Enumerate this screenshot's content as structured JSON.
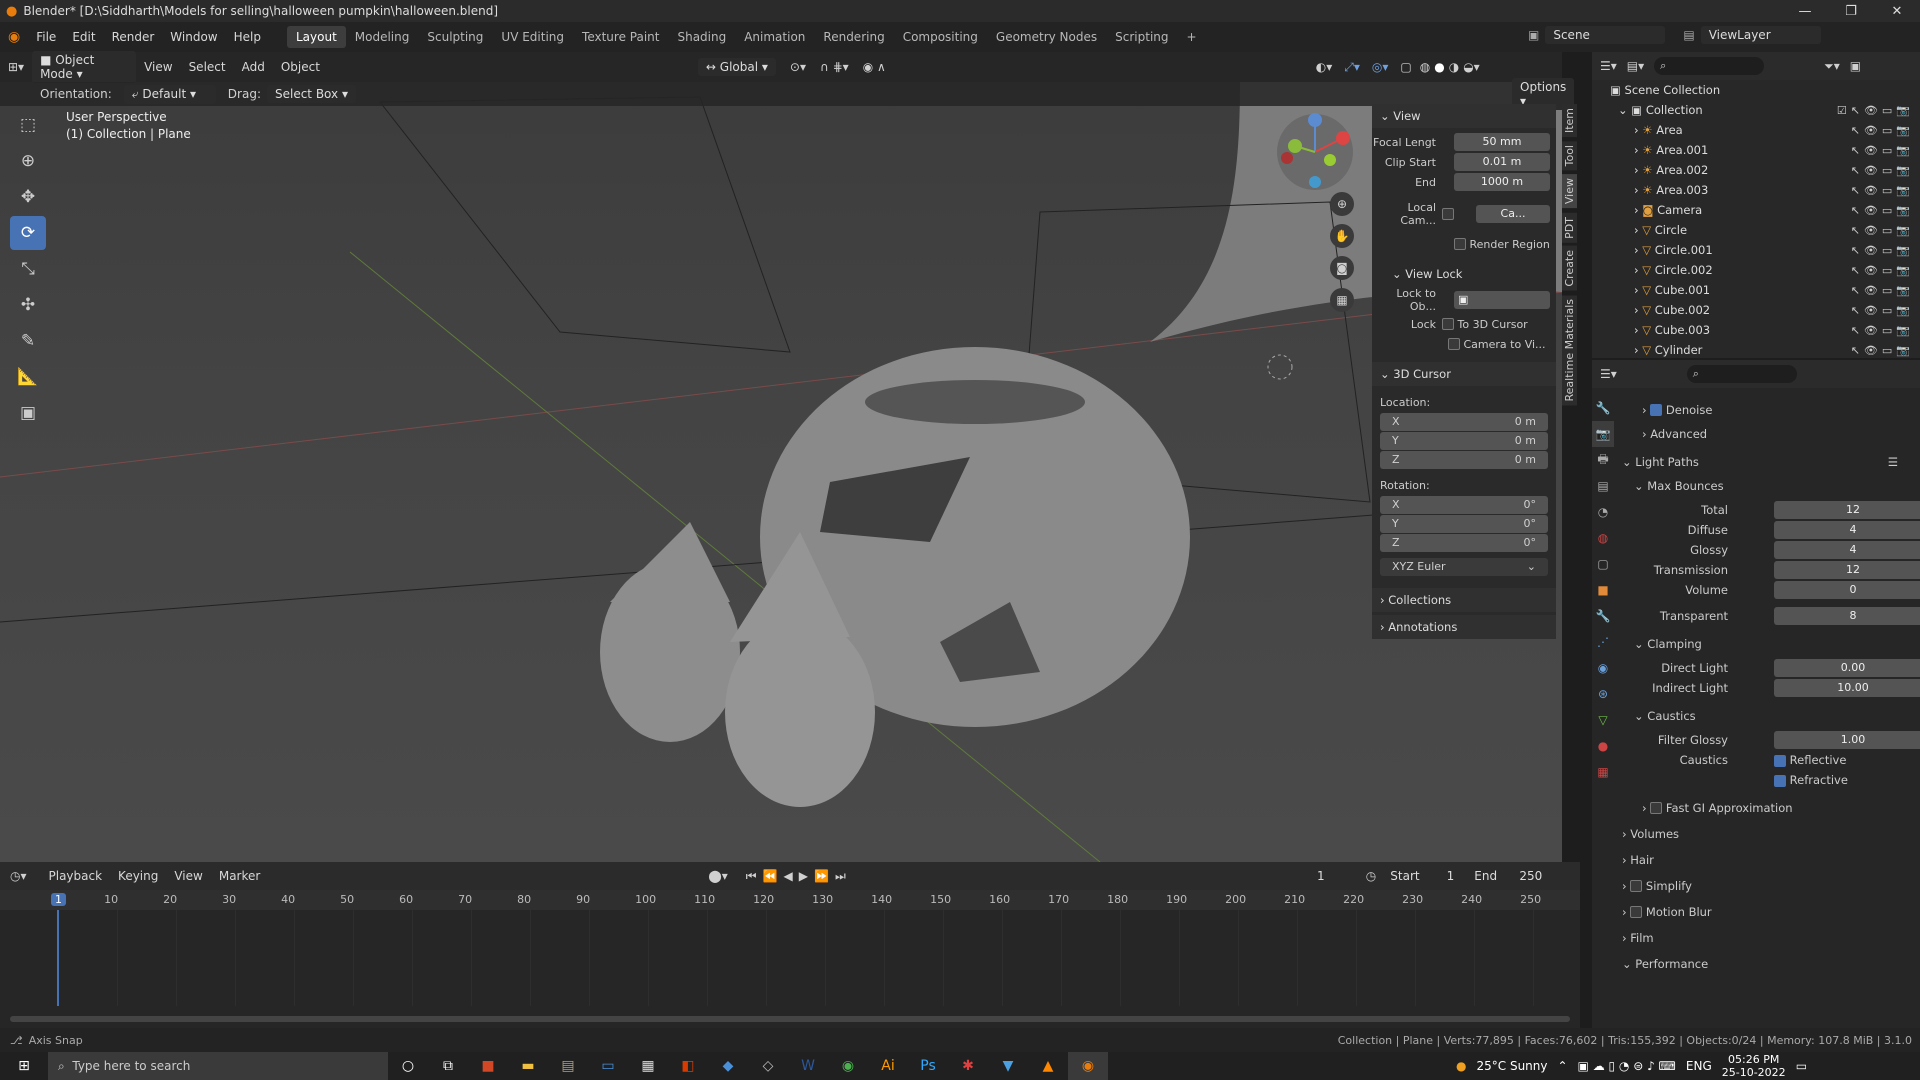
{
  "titlebar": {
    "title": "Blender* [D:\\Siddharth\\Models for selling\\halloween pumpkin\\halloween.blend]",
    "minimize": "—",
    "maximize": "❐",
    "close": "✕"
  },
  "menu": [
    "File",
    "Edit",
    "Render",
    "Window",
    "Help"
  ],
  "workspaces": [
    "Layout",
    "Modeling",
    "Sculpting",
    "UV Editing",
    "Texture Paint",
    "Shading",
    "Animation",
    "Rendering",
    "Compositing",
    "Geometry Nodes",
    "Scripting",
    "+"
  ],
  "scene": {
    "label": "Scene",
    "viewlayer": "ViewLayer"
  },
  "viewport_header": {
    "mode": "Object Mode",
    "menus": [
      "View",
      "Select",
      "Add",
      "Object"
    ],
    "transform": "Global",
    "orientation_label": "Orientation:",
    "orientation_value": "Default",
    "drag_label": "Drag:",
    "drag_value": "Select Box",
    "options": "Options"
  },
  "viewport_info": {
    "line1": "User Perspective",
    "line2": "(1) Collection | Plane"
  },
  "npanel": {
    "view_title": "View",
    "focal_label": "Focal Lengt",
    "focal": "50 mm",
    "clip_start_label": "Clip Start",
    "clip_start": "0.01 m",
    "end_label": "End",
    "end": "1000 m",
    "local_cam_label": "Local Cam...",
    "local_cam": "Ca...",
    "render_region": "Render Region",
    "view_lock_title": "View Lock",
    "lock_to_obj": "Lock to Ob...",
    "lock_label": "Lock",
    "to_3d_cursor": "To 3D Cursor",
    "camera_to_view": "Camera to Vi...",
    "cursor_title": "3D Cursor",
    "location_label": "Location:",
    "loc_x": "0 m",
    "loc_y": "0 m",
    "loc_z": "0 m",
    "rotation_label": "Rotation:",
    "rot_x": "0°",
    "rot_y": "0°",
    "rot_z": "0°",
    "rot_mode": "XYZ Euler",
    "collections": "Collections",
    "annotations": "Annotations"
  },
  "side_tabs": [
    "Item",
    "Tool",
    "View",
    "PDT",
    "Create",
    "Realtime Materials"
  ],
  "outliner": {
    "root": "Scene Collection",
    "collection": "Collection",
    "items": [
      "Area",
      "Area.001",
      "Area.002",
      "Area.003",
      "Camera",
      "Circle",
      "Circle.001",
      "Circle.002",
      "Cube.001",
      "Cube.002",
      "Cube.003",
      "Cylinder"
    ]
  },
  "properties": {
    "denoise": "Denoise",
    "advanced": "Advanced",
    "light_paths": "Light Paths",
    "max_bounces": "Max Bounces",
    "total_label": "Total",
    "total": "12",
    "diffuse_label": "Diffuse",
    "diffuse": "4",
    "glossy_label": "Glossy",
    "glossy": "4",
    "transmission_label": "Transmission",
    "transmission": "12",
    "volume_label": "Volume",
    "volume": "0",
    "transparent_label": "Transparent",
    "transparent": "8",
    "clamping": "Clamping",
    "direct_light_label": "Direct Light",
    "direct_light": "0.00",
    "indirect_light_label": "Indirect Light",
    "indirect_light": "10.00",
    "caustics_sec": "Caustics",
    "filter_glossy_label": "Filter Glossy",
    "filter_glossy": "1.00",
    "caustics_label": "Caustics",
    "reflective": "Reflective",
    "refractive": "Refractive",
    "fast_gi": "Fast GI Approximation",
    "volumes": "Volumes",
    "hair": "Hair",
    "simplify": "Simplify",
    "motion_blur": "Motion Blur",
    "film": "Film",
    "performance": "Performance"
  },
  "timeline": {
    "menus": [
      "Playback",
      "Keying",
      "View",
      "Marker"
    ],
    "current_frame": "1",
    "start_label": "Start",
    "start": "1",
    "end_label": "End",
    "end": "250",
    "ticks": [
      "1",
      "10",
      "20",
      "30",
      "40",
      "50",
      "60",
      "70",
      "80",
      "90",
      "100",
      "110",
      "120",
      "130",
      "140",
      "150",
      "160",
      "170",
      "180",
      "190",
      "200",
      "210",
      "220",
      "230",
      "240",
      "250"
    ]
  },
  "statusbar": {
    "left": "Axis Snap",
    "right": "Collection | Plane | Verts:77,895 | Faces:76,602 | Tris:155,392 | Objects:0/24 | Memory: 107.8 MiB | 3.1.0"
  },
  "taskbar": {
    "search": "Type here to search",
    "weather": "25°C  Sunny",
    "lang": "ENG",
    "time": "05:26 PM",
    "date": "25-10-2022"
  }
}
